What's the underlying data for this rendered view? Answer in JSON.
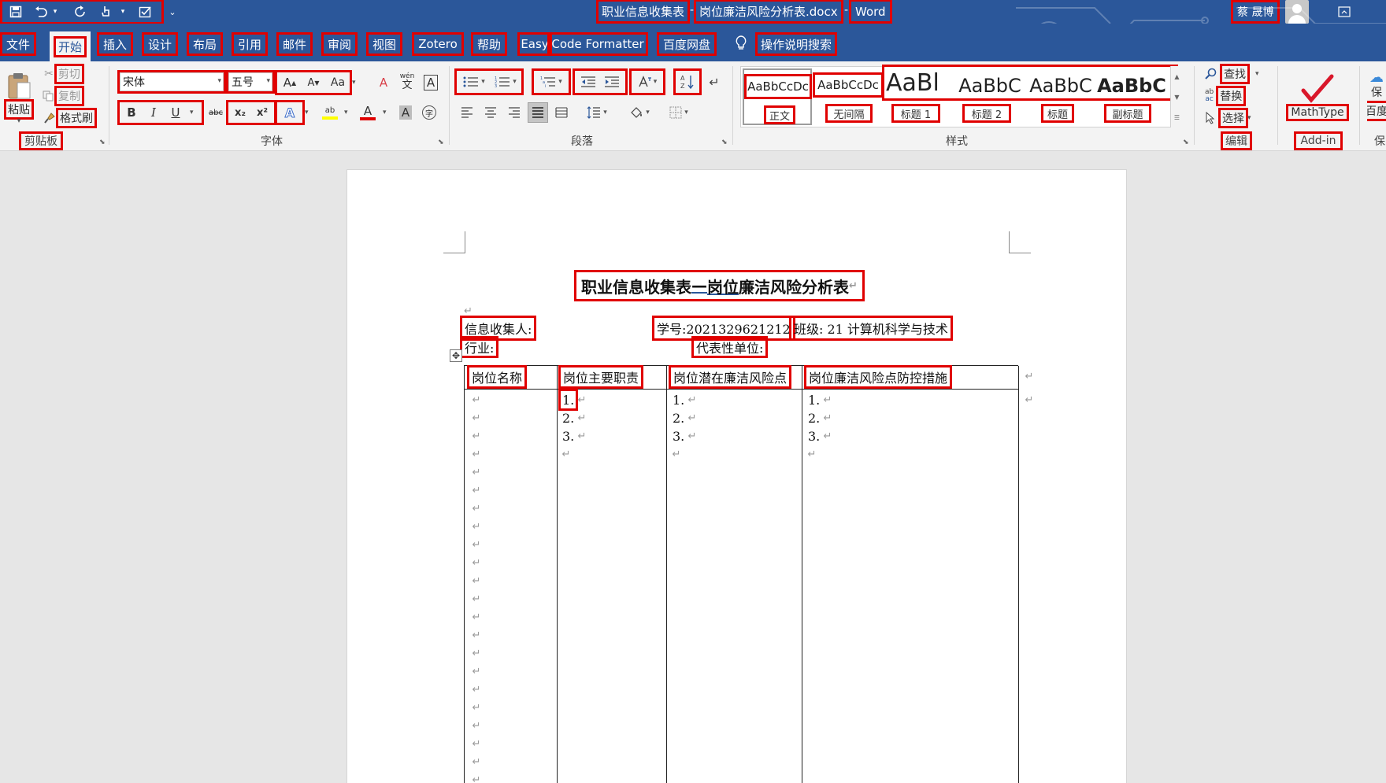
{
  "titlebar": {
    "title": "职业信息收集表",
    "filename": "岗位廉洁风险分析表.docx",
    "separator": "-",
    "app": "Word",
    "user": "蔡 晟博"
  },
  "tabs": [
    "文件",
    "开始",
    "插入",
    "设计",
    "布局",
    "引用",
    "邮件",
    "审阅",
    "视图",
    "Zotero",
    "帮助",
    "Easy",
    "Code Formatter",
    "百度网盘"
  ],
  "tell_me": "操作说明搜索",
  "ribbon": {
    "clipboard": {
      "paste": "粘贴",
      "cut": "剪切",
      "copy": "复制",
      "format_painter": "格式刷",
      "label": "剪贴板"
    },
    "font": {
      "name": "宋体",
      "size": "五号",
      "label": "字体",
      "grow": "A",
      "shrink": "A",
      "case": "Aa",
      "clear_format": "A",
      "phonetic": "wén",
      "char_border": "A",
      "bold": "B",
      "italic": "I",
      "underline": "U",
      "strike": "abc",
      "subscript": "x₂",
      "superscript": "x²",
      "text_effects": "A",
      "highlight": "ab",
      "font_color": "A",
      "char_shading": "A",
      "enclose": "字"
    },
    "paragraph": {
      "label": "段落"
    },
    "styles": {
      "label": "样式",
      "items": [
        {
          "preview": "AaBbCcDc",
          "name": "正文"
        },
        {
          "preview": "AaBbCcDc",
          "name": "无间隔"
        },
        {
          "preview": "AaBl",
          "name": "标题 1"
        },
        {
          "preview": "AaBbC",
          "name": "标题 2"
        },
        {
          "preview": "AaBbC",
          "name": "标题"
        },
        {
          "preview": "AaBbC",
          "name": "副标题"
        }
      ]
    },
    "editing": {
      "find": "查找",
      "replace": "替换",
      "select": "选择",
      "label": "编辑"
    },
    "addin": {
      "mathtype": "MathType",
      "label": "Add-in"
    },
    "partial": {
      "top": "保",
      "mid": "百度",
      "bottom": "保"
    }
  },
  "document": {
    "title_part1": "职业信息收集表",
    "title_dash": "—",
    "title_part2": "岗位",
    "title_part3": "廉洁风险分析表",
    "collector": "信息收集人:",
    "student_id": "学号:2021329621212",
    "class": "班级: 21 计算机科学与技术",
    "industry": "行业:",
    "unit": "代表性单位:",
    "table": {
      "headers": [
        "岗位名称",
        "岗位主要职责",
        "岗位潜在廉洁风险点",
        "岗位廉洁风险点防控措施"
      ],
      "numbering": [
        "1.",
        "2.",
        "3."
      ]
    }
  },
  "colors": {
    "word_blue": "#2b579a",
    "annotation_red": "#e00000",
    "mathtype_red": "#d9172a"
  }
}
